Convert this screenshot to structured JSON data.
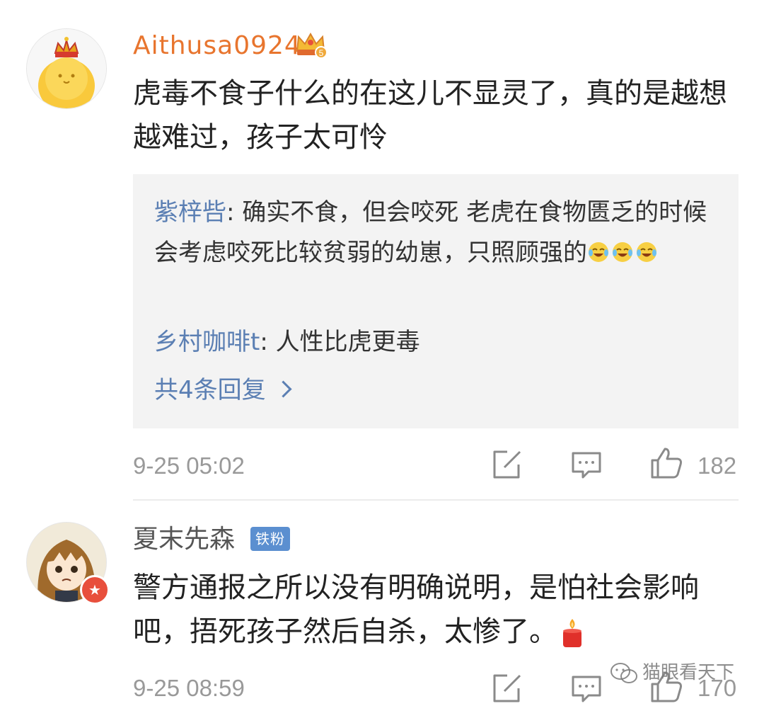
{
  "comments": [
    {
      "username": "Aithusa0924",
      "badge": "crown-level-5",
      "text": "虎毒不食子什么的在这儿不显灵了，真的是越想越难过，孩子太可怜",
      "replies": [
        {
          "user": "紫梓呰",
          "separator": ": ",
          "text": "确实不食，但会咬死 老虎在食物匮乏的时候会考虑咬死比较贫弱的幼崽，只照顾强的",
          "emoji": [
            "laugh-cry-emoji",
            "laugh-cry-emoji",
            "laugh-cry-emoji"
          ]
        },
        {
          "user": "乡村咖啡t",
          "separator": ": ",
          "text": "人性比虎更毒"
        }
      ],
      "more_replies": "共4条回复",
      "timestamp": "9-25 05:02",
      "likes": "182"
    },
    {
      "username": "夏末先森",
      "badge_label": "铁粉",
      "text": "警方通报之所以没有明确说明，是怕社会影响吧，捂死孩子然后自杀，太惨了。",
      "trailing_emoji": "candle-emoji",
      "timestamp": "9-25 08:59",
      "likes": "170"
    }
  ],
  "watermark": "猫眼看天下",
  "colors": {
    "username_vip": "#e8752e",
    "reply_user": "#5b7fb3",
    "fan_badge": "#5b8fd0",
    "meta_gray": "#999999",
    "reply_bg": "#f3f3f3"
  }
}
